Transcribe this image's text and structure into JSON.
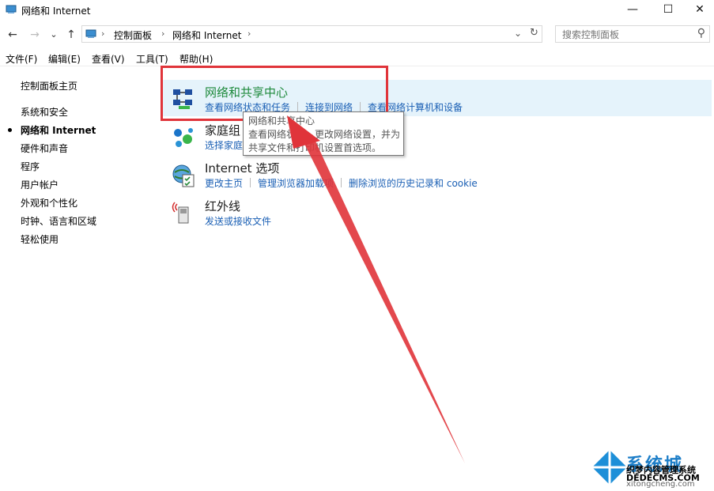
{
  "window": {
    "title": "网络和 Internet",
    "minimize_glyph": "—",
    "maximize_glyph": "☐",
    "close_glyph": "✕"
  },
  "nav": {
    "back_glyph": "←",
    "forward_glyph": "→",
    "recent_glyph": "⌄",
    "up_glyph": "↑"
  },
  "address": {
    "breadcrumb": [
      "控制面板",
      "网络和 Internet"
    ],
    "separator": "›",
    "dropdown_glyph": "⌄",
    "refresh_glyph": "↻"
  },
  "search": {
    "placeholder": "搜索控制面板",
    "icon_glyph": "⚲"
  },
  "menubar": [
    "文件(F)",
    "编辑(E)",
    "查看(V)",
    "工具(T)",
    "帮助(H)"
  ],
  "sidebar": {
    "home": "控制面板主页",
    "items": [
      "系统和安全",
      "网络和 Internet",
      "硬件和声音",
      "程序",
      "用户帐户",
      "外观和个性化",
      "时钟、语言和区域",
      "轻松使用"
    ],
    "active_index": 1
  },
  "categories": [
    {
      "title": "网络和共享中心",
      "links": [
        "查看网络状态和任务",
        "连接到网络",
        "查看网络计算机和设备"
      ],
      "icon": "network-sharing-center-icon"
    },
    {
      "title": "家庭组",
      "links": [
        "选择家庭"
      ],
      "icon": "homegroup-icon"
    },
    {
      "title": "Internet 选项",
      "links": [
        "更改主页",
        "管理浏览器加载项",
        "删除浏览的历史记录和 cookie"
      ],
      "icon": "internet-options-icon"
    },
    {
      "title": "红外线",
      "links": [
        "发送或接收文件"
      ],
      "icon": "infrared-icon"
    }
  ],
  "tooltip": {
    "lines": [
      "网络和共享中心",
      "查看网络状态、更改网络设置，并为",
      "共享文件和打印机设置首选项。"
    ]
  },
  "watermark": {
    "line1": "系统城",
    "line2": "织梦内容管理系统",
    "line3": "DEDECMS.COM",
    "line4": "xitongcheng.com"
  },
  "colors": {
    "link": "#1a5fb4",
    "title_green": "#1e8a3c",
    "annotation_red": "#e0343a",
    "hover_bg": "#e5f3fb"
  }
}
